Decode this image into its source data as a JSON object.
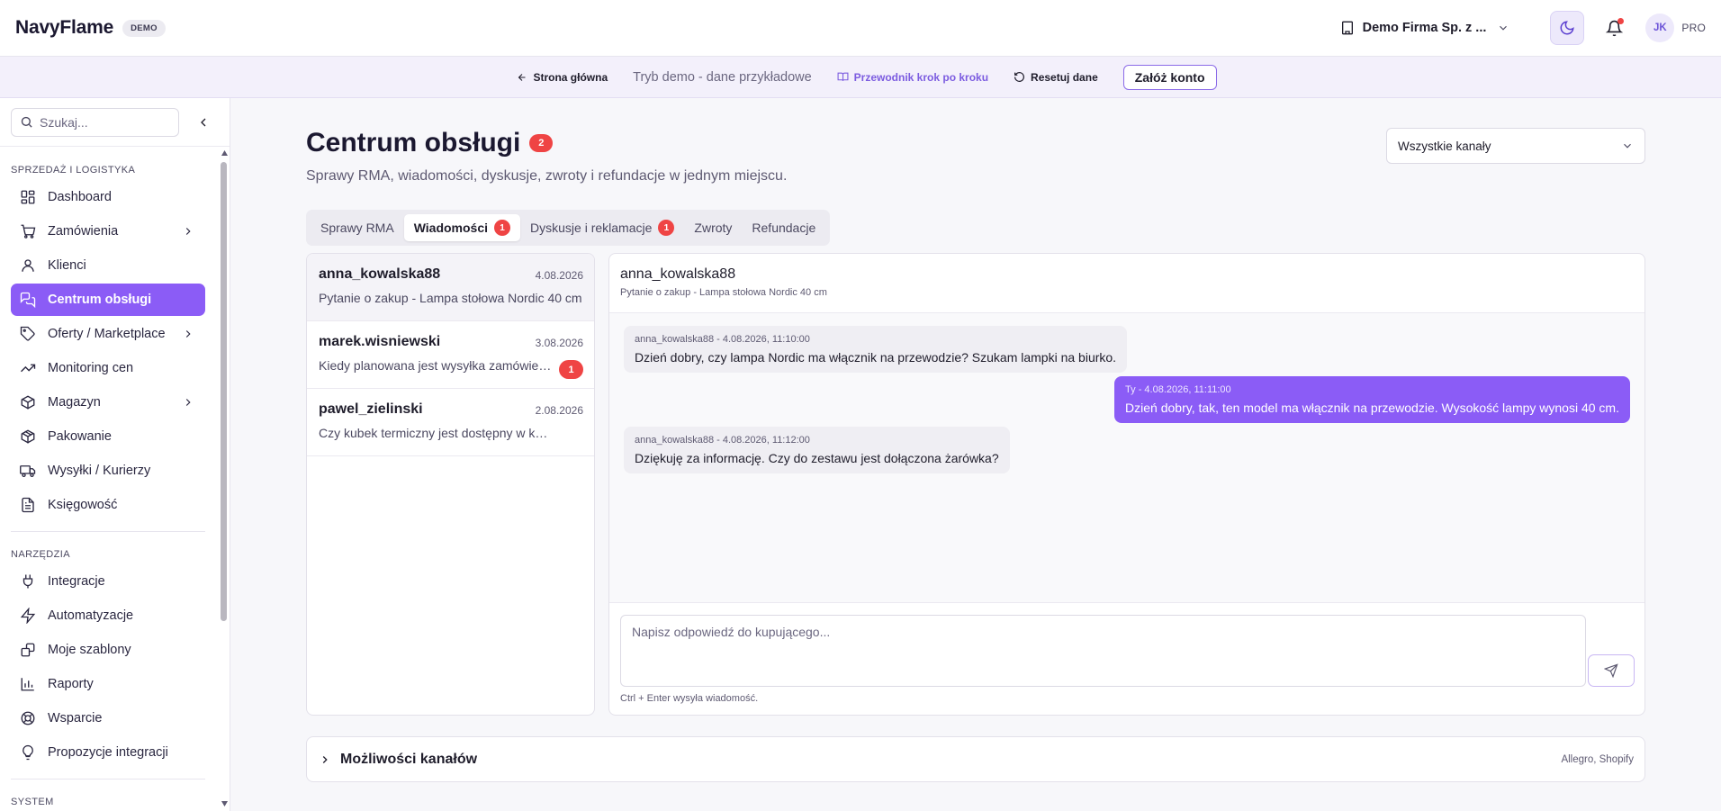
{
  "header": {
    "brand": "NavyFlame",
    "badge": "DEMO",
    "company": "Demo Firma Sp. z ...",
    "avatar_initials": "JK",
    "plan": "PRO",
    "accent": "#8b5cf6"
  },
  "demobar": {
    "home": "Strona główna",
    "mode": "Tryb demo - dane przykładowe",
    "guide": "Przewodnik krok po kroku",
    "reset": "Resetuj dane",
    "create_account": "Załóż konto"
  },
  "sidebar": {
    "search_placeholder": "Szukaj...",
    "sections": [
      {
        "title": "SPRZEDAŻ I LOGISTYKA",
        "items": [
          {
            "label": "Dashboard",
            "icon": "dashboard-icon"
          },
          {
            "label": "Zamówienia",
            "icon": "cart-icon",
            "expandable": true
          },
          {
            "label": "Klienci",
            "icon": "user-icon"
          },
          {
            "label": "Centrum obsługi",
            "icon": "chat-icon",
            "active": true
          },
          {
            "label": "Oferty / Marketplace",
            "icon": "tag-icon",
            "expandable": true
          },
          {
            "label": "Monitoring cen",
            "icon": "trend-icon"
          },
          {
            "label": "Magazyn",
            "icon": "box-icon",
            "expandable": true
          },
          {
            "label": "Pakowanie",
            "icon": "package-icon"
          },
          {
            "label": "Wysyłki / Kurierzy",
            "icon": "truck-icon"
          },
          {
            "label": "Księgowość",
            "icon": "document-icon"
          }
        ]
      },
      {
        "title": "NARZĘDZIA",
        "items": [
          {
            "label": "Integracje",
            "icon": "plug-icon"
          },
          {
            "label": "Automatyzacje",
            "icon": "bolt-icon"
          },
          {
            "label": "Moje szablony",
            "icon": "templates-icon"
          },
          {
            "label": "Raporty",
            "icon": "chart-icon"
          },
          {
            "label": "Wsparcie",
            "icon": "lifebuoy-icon"
          },
          {
            "label": "Propozycje integracji",
            "icon": "lightbulb-icon"
          }
        ]
      },
      {
        "title": "SYSTEM",
        "items": []
      }
    ]
  },
  "main": {
    "title": "Centrum obsługi",
    "title_count": "2",
    "subtitle": "Sprawy RMA, wiadomości, dyskusje, zwroty i refundacje w jednym miejscu.",
    "channel_filter": "Wszystkie kanały",
    "tabs": [
      {
        "label": "Sprawy RMA",
        "badge": ""
      },
      {
        "label": "Wiadomości",
        "badge": "1",
        "active": true
      },
      {
        "label": "Dyskusje i reklamacje",
        "badge": "1"
      },
      {
        "label": "Zwroty",
        "badge": ""
      },
      {
        "label": "Refundacje",
        "badge": ""
      }
    ],
    "conversations": [
      {
        "name": "anna_kowalska88",
        "date": "4.08.2026",
        "preview": "Pytanie o zakup - Lampa stołowa Nordic 40 cm",
        "unread": "",
        "selected": true
      },
      {
        "name": "marek.wisniewski",
        "date": "3.08.2026",
        "preview": "Kiedy planowana jest wysyłka zamówienia?",
        "unread": "1"
      },
      {
        "name": "pawel_zielinski",
        "date": "2.08.2026",
        "preview": "Czy kubek termiczny jest dostępny w kolorze czarnym?",
        "unread": ""
      }
    ],
    "chat": {
      "user": "anna_kowalska88",
      "subject": "Pytanie o zakup - Lampa stołowa Nordic 40 cm",
      "messages": [
        {
          "meta": "anna_kowalska88 - 4.08.2026, 11:10:00",
          "text": "Dzień dobry, czy lampa Nordic ma włącznik na przewodzie? Szukam lampki na biurko.",
          "dir": "in"
        },
        {
          "meta": "Ty - 4.08.2026, 11:11:00",
          "text": "Dzień dobry, tak, ten model ma włącznik na przewodzie. Wysokość lampy wynosi 40 cm.",
          "dir": "out"
        },
        {
          "meta": "anna_kowalska88 - 4.08.2026, 11:12:00",
          "text": "Dziękuję za informację. Czy do zestawu jest dołączona żarówka?",
          "dir": "in"
        }
      ],
      "reply_placeholder": "Napisz odpowiedź do kupującego...",
      "hint": "Ctrl + Enter wysyła wiadomość."
    },
    "capabilities": {
      "title": "Możliwości kanałów",
      "channels": "Allegro, Shopify"
    }
  }
}
